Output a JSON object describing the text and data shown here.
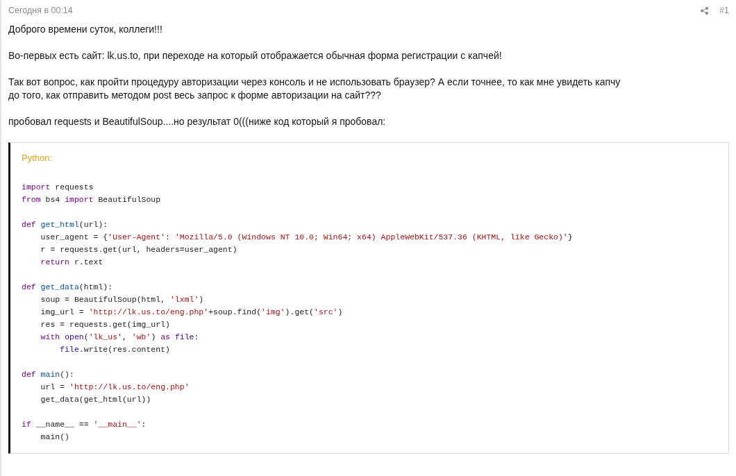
{
  "post": {
    "date": "Сегодня в 00:14",
    "number": "#1",
    "paragraphs": [
      {
        "lines": [
          "Доброго времени суток, коллеги!!!"
        ]
      },
      {
        "lines": [
          "Во-первых есть сайт: lk.us.to, при переходе на который отображается обычная форма регистрации с капчей!"
        ]
      },
      {
        "lines": [
          "Так вот вопрос, как пройти процедуру авторизации через консоль и не использовать браузер? А если точнее, то как мне увидеть капчу",
          "до того, как отправить методом post весь запрос к форме авторизации на сайт???"
        ]
      },
      {
        "lines": [
          "пробовал requests и BeautifulSoup....но результат 0(((ниже код который я пробовал:"
        ]
      }
    ],
    "code": {
      "language": "Python:",
      "lines": [
        {
          "kind": "blank"
        },
        {
          "kind": "code",
          "tokens": [
            {
              "kind": "kw",
              "s": "import"
            },
            {
              "kind": "plain",
              "s": " requests"
            }
          ]
        },
        {
          "kind": "code",
          "tokens": [
            {
              "kind": "kw",
              "s": "from"
            },
            {
              "kind": "plain",
              "s": " bs4 "
            },
            {
              "kind": "kw",
              "s": "import"
            },
            {
              "kind": "plain",
              "s": " BeautifulSoup"
            }
          ]
        },
        {
          "kind": "blank"
        },
        {
          "kind": "code",
          "tokens": [
            {
              "kind": "kw",
              "s": "def "
            },
            {
              "kind": "fn",
              "s": "get_html"
            },
            {
              "kind": "plain",
              "s": "(url):"
            }
          ]
        },
        {
          "kind": "code",
          "tokens": [
            {
              "kind": "plain",
              "s": "    user_agent = {"
            },
            {
              "kind": "str",
              "s": "'User-Agent'"
            },
            {
              "kind": "plain",
              "s": ": "
            },
            {
              "kind": "str",
              "s": "'Mozilla/5.0 (Windows NT 10.0; Win64; x64) AppleWebKit/537.36 (KHTML, like Gecko)'"
            },
            {
              "kind": "plain",
              "s": "}"
            }
          ]
        },
        {
          "kind": "code",
          "tokens": [
            {
              "kind": "plain",
              "s": "    r = requests.get(url, headers=user_agent)"
            }
          ]
        },
        {
          "kind": "code",
          "tokens": [
            {
              "kind": "kw",
              "s": "    return"
            },
            {
              "kind": "plain",
              "s": " r.text"
            }
          ]
        },
        {
          "kind": "blank"
        },
        {
          "kind": "code",
          "tokens": [
            {
              "kind": "kw",
              "s": "def "
            },
            {
              "kind": "fn",
              "s": "get_data"
            },
            {
              "kind": "plain",
              "s": "(html):"
            }
          ]
        },
        {
          "kind": "code",
          "tokens": [
            {
              "kind": "plain",
              "s": "    soup = BeautifulSoup(html, "
            },
            {
              "kind": "str",
              "s": "'lxml'"
            },
            {
              "kind": "plain",
              "s": ")"
            }
          ]
        },
        {
          "kind": "code",
          "tokens": [
            {
              "kind": "plain",
              "s": "    img_url = "
            },
            {
              "kind": "str",
              "s": "'http://lk.us.to/eng.php'"
            },
            {
              "kind": "plain",
              "s": "+soup.find("
            },
            {
              "kind": "str",
              "s": "'img'"
            },
            {
              "kind": "plain",
              "s": ").get("
            },
            {
              "kind": "str",
              "s": "'src'"
            },
            {
              "kind": "plain",
              "s": ")"
            }
          ]
        },
        {
          "kind": "code",
          "tokens": [
            {
              "kind": "plain",
              "s": "    res = requests.get(img_url)"
            }
          ]
        },
        {
          "kind": "code",
          "tokens": [
            {
              "kind": "kw",
              "s": "    with "
            },
            {
              "kind": "builtin",
              "s": "open"
            },
            {
              "kind": "plain",
              "s": "("
            },
            {
              "kind": "str",
              "s": "'lk_us'"
            },
            {
              "kind": "plain",
              "s": ", "
            },
            {
              "kind": "str",
              "s": "'wb'"
            },
            {
              "kind": "plain",
              "s": ") "
            },
            {
              "kind": "kw",
              "s": "as "
            },
            {
              "kind": "builtin",
              "s": "file"
            },
            {
              "kind": "plain",
              "s": ":"
            }
          ]
        },
        {
          "kind": "code",
          "tokens": [
            {
              "kind": "builtin",
              "s": "        file"
            },
            {
              "kind": "plain",
              "s": ".write(res.content)"
            }
          ]
        },
        {
          "kind": "blank"
        },
        {
          "kind": "code",
          "tokens": [
            {
              "kind": "kw",
              "s": "def "
            },
            {
              "kind": "fn",
              "s": "main"
            },
            {
              "kind": "plain",
              "s": "():"
            }
          ]
        },
        {
          "kind": "code",
          "tokens": [
            {
              "kind": "plain",
              "s": "    url = "
            },
            {
              "kind": "str",
              "s": "'http://lk.us.to/eng.php'"
            }
          ]
        },
        {
          "kind": "code",
          "tokens": [
            {
              "kind": "plain",
              "s": "    get_data(get_html(url))"
            }
          ]
        },
        {
          "kind": "blank"
        },
        {
          "kind": "code",
          "tokens": [
            {
              "kind": "kw",
              "s": "if"
            },
            {
              "kind": "plain",
              "s": " __name__ == "
            },
            {
              "kind": "str",
              "s": "'__main__'"
            },
            {
              "kind": "plain",
              "s": ":"
            }
          ]
        },
        {
          "kind": "code",
          "tokens": [
            {
              "kind": "plain",
              "s": "    main()"
            }
          ]
        }
      ]
    }
  }
}
